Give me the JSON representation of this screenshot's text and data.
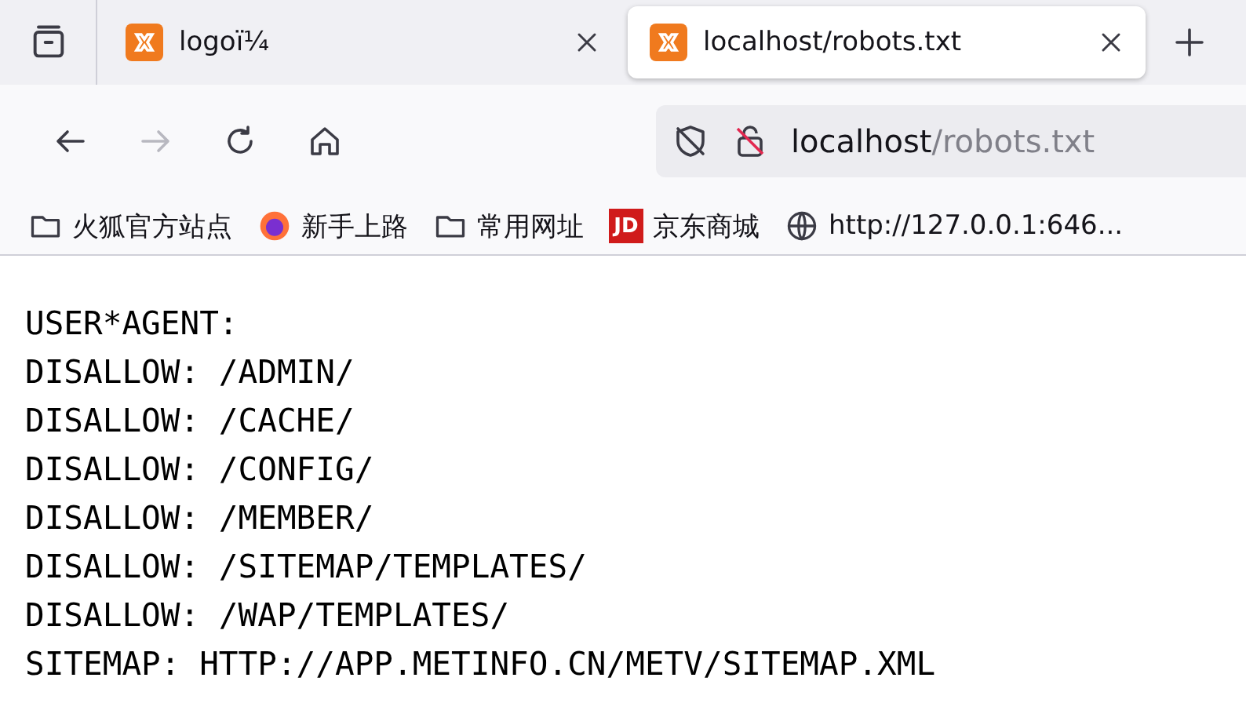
{
  "tabs": [
    {
      "title": "logoï¼",
      "selected": false
    },
    {
      "title": "localhost/robots.txt",
      "selected": true
    }
  ],
  "nav": [
    {
      "kind": "back",
      "disabled": false
    },
    {
      "kind": "forward",
      "disabled": true
    },
    {
      "kind": "reload",
      "disabled": false
    },
    {
      "kind": "home",
      "disabled": false
    }
  ],
  "url": {
    "host": "localhost",
    "path": "/robots.txt"
  },
  "bookmarks": [
    {
      "kind": "folder",
      "label": "火狐官方站点"
    },
    {
      "kind": "firefox",
      "label": "新手上路"
    },
    {
      "kind": "folder",
      "label": "常用网址"
    },
    {
      "kind": "jd",
      "logo": "JD",
      "label": "京东商城"
    },
    {
      "kind": "globe",
      "label": "http://127.0.0.1:646..."
    }
  ],
  "content": [
    "USER*AGENT:",
    "DISALLOW: /ADMIN/",
    "DISALLOW: /CACHE/",
    "DISALLOW: /CONFIG/",
    "DISALLOW: /MEMBER/",
    "DISALLOW: /SITEMAP/TEMPLATES/",
    "DISALLOW: /WAP/TEMPLATES/",
    "SITEMAP: HTTP://APP.METINFO.CN/METV/SITEMAP.XML"
  ]
}
